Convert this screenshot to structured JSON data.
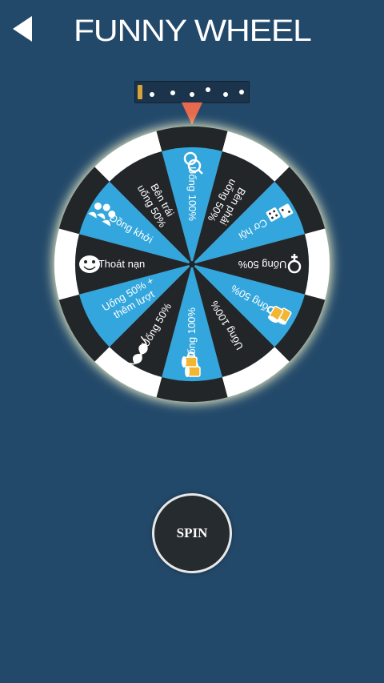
{
  "header": {
    "back_icon": "back-arrow-icon",
    "title": "FUNNY WHEEL"
  },
  "indicator": {
    "dots": 6
  },
  "wheel": {
    "colors": {
      "blue": "#33a6dd",
      "dark": "#222628",
      "rim": "#ffffff",
      "glow": "#f5f5c8"
    },
    "segments": [
      {
        "label": "Uống 100%",
        "icon": "gender-symbol-icon"
      },
      {
        "label": "Bên phải uống 50%",
        "icon": ""
      },
      {
        "label": "Cơ hội",
        "icon": "dice-icon"
      },
      {
        "label": "Uống 50%",
        "icon": "female-symbol-icon"
      },
      {
        "label": "Uống 50%",
        "icon": "beer-mug-icon"
      },
      {
        "label": "Uống 100%",
        "icon": ""
      },
      {
        "label": "Uống 100%",
        "icon": "beer-mugs-icon"
      },
      {
        "label": "Uống 50%",
        "icon": "bra-icon"
      },
      {
        "label": "Uống 50% + thêm lượt",
        "icon": ""
      },
      {
        "label": "Thoát nạn",
        "icon": "meme-face-icon"
      },
      {
        "label": "Đồng khởi",
        "icon": "group-people-icon"
      },
      {
        "label": "Bên trái uống 50%",
        "icon": ""
      }
    ]
  },
  "spin": {
    "label": "SPIN"
  }
}
